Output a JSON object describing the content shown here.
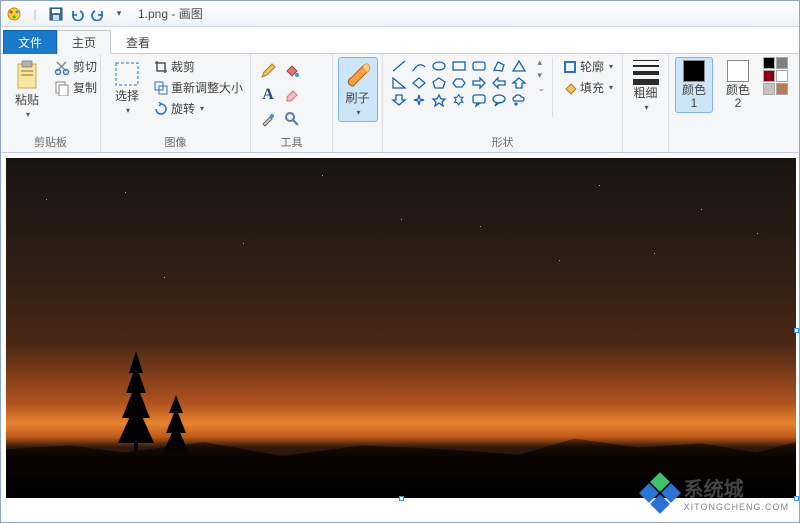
{
  "title": {
    "filename": "1.png",
    "sep": "-",
    "app": "画图"
  },
  "qat": {
    "save": "保存",
    "undo": "撤销",
    "redo": "重做"
  },
  "tabs": {
    "file": "文件",
    "home": "主页",
    "view": "查看"
  },
  "ribbon": {
    "clipboard": {
      "paste": "粘贴",
      "cut": "剪切",
      "copy": "复制",
      "label": "剪贴板"
    },
    "image": {
      "select": "选择",
      "crop": "裁剪",
      "resize": "重新调整大小",
      "rotate": "旋转",
      "label": "图像"
    },
    "tools": {
      "label": "工具",
      "items": [
        "pencil",
        "bucket",
        "text",
        "eraser",
        "picker",
        "magnifier"
      ]
    },
    "brushes": {
      "text": "刷子",
      "label": ""
    },
    "shapes": {
      "outline": "轮廓",
      "fill": "填充",
      "label": "形状"
    },
    "size": {
      "text": "粗细",
      "label": ""
    },
    "colors": {
      "color1": "颜色 1",
      "color2": "颜色 2",
      "label": ""
    }
  },
  "colors": {
    "primary": "#000000",
    "secondary": "#ffffff",
    "palette": [
      "#000000",
      "#7f7f7f",
      "#880015",
      "#ed1c24",
      "#ff7f27",
      "#fff200",
      "#22b14c",
      "#00a2e8",
      "#3f48cc",
      "#a349a4",
      "#ffffff",
      "#c3c3c3"
    ]
  },
  "watermark": {
    "text": "系统城",
    "url": "XITONGCHENG.COM"
  }
}
